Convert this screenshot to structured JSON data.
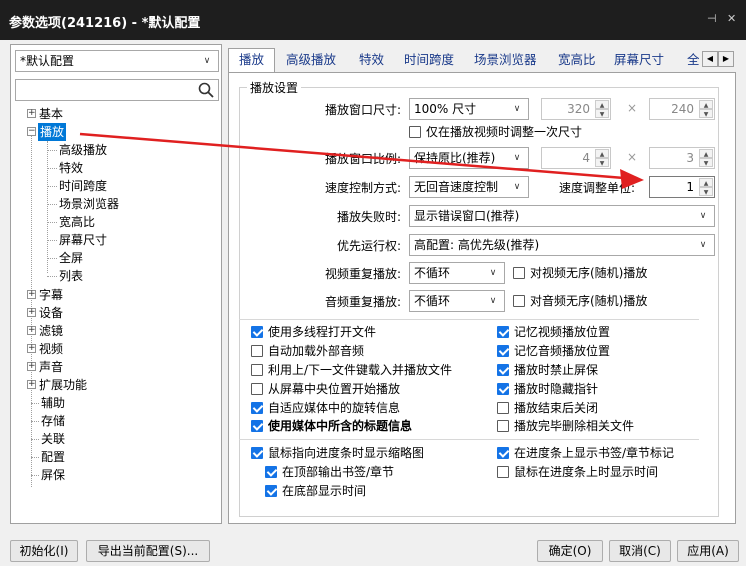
{
  "window": {
    "title": "参数选项(241216) - *默认配置",
    "pin_glyph": "⊣",
    "close_glyph": "✕"
  },
  "profile_select": {
    "value": "*默认配置"
  },
  "search": {
    "placeholder": ""
  },
  "tree": {
    "basic": "基本",
    "playback": "播放",
    "playback_children": [
      "高级播放",
      "特效",
      "时间跨度",
      "场景浏览器",
      "宽高比",
      "屏幕尺寸",
      "全屏",
      "列表"
    ],
    "subtitle": "字幕",
    "device": "设备",
    "filter": "滤镜",
    "video": "视频",
    "audio": "声音",
    "extension": "扩展功能",
    "assist": "辅助",
    "storage": "存储",
    "association": "关联",
    "config": "配置",
    "skin": "屏保"
  },
  "tabs": [
    "播放",
    "高级播放",
    "特效",
    "时间跨度",
    "场景浏览器",
    "宽高比",
    "屏幕尺寸",
    "全"
  ],
  "group": {
    "title": "播放设置"
  },
  "rows": {
    "window_size": {
      "label": "播放窗口尺寸:",
      "value": "100% 尺寸",
      "w": "320",
      "h": "240",
      "times": "×"
    },
    "only_on_start": "仅在播放视频时调整一次尺寸",
    "aspect": {
      "label": "播放窗口比例:",
      "value": "保持原比(推荐)",
      "w": "4",
      "h": "3",
      "times": "×"
    },
    "speed_mode": {
      "label": "速度控制方式:",
      "value": "无回音速度控制"
    },
    "speed_unit": {
      "label": "速度调整单位:",
      "value": "1"
    },
    "on_fail": {
      "label": "播放失败时:",
      "value": "显示错误窗口(推荐)"
    },
    "priority": {
      "label": "优先运行权:",
      "value": "高配置: 高优先级(推荐)"
    },
    "video_repeat": {
      "label": "视频重复播放:",
      "value": "不循环",
      "random": "对视频无序(随机)播放"
    },
    "audio_repeat": {
      "label": "音频重复播放:",
      "value": "不循环",
      "random": "对音频无序(随机)播放"
    }
  },
  "checks_left": [
    {
      "label": "使用多线程打开文件",
      "checked": true
    },
    {
      "label": "自动加载外部音频",
      "checked": false
    },
    {
      "label": "利用上/下一文件键载入并播放文件",
      "checked": false
    },
    {
      "label": "从屏幕中央位置开始播放",
      "checked": false
    },
    {
      "label": "自适应媒体中的旋转信息",
      "checked": true
    },
    {
      "label": "使用媒体中所含的标题信息",
      "checked": true
    }
  ],
  "checks_right": [
    {
      "label": "记忆视频播放位置",
      "checked": true
    },
    {
      "label": "记忆音频播放位置",
      "checked": true
    },
    {
      "label": "播放时禁止屏保",
      "checked": true
    },
    {
      "label": "播放时隐藏指针",
      "checked": true
    },
    {
      "label": "播放结束后关闭",
      "checked": false
    },
    {
      "label": "播放完毕删除相关文件",
      "checked": false
    }
  ],
  "checks_bottom": {
    "thumb": {
      "label": "鼠标指向进度条时显示缩略图",
      "checked": true
    },
    "bookmark": {
      "label": "在进度条上显示书签/章节标记",
      "checked": true
    },
    "top_bookmark": {
      "label": "在顶部输出书签/章节",
      "checked": true
    },
    "bottom_time": {
      "label": "在底部显示时间",
      "checked": true
    },
    "mouse_time": {
      "label": "鼠标在进度条上时显示时间",
      "checked": false
    }
  },
  "buttons": {
    "init": "初始化(I)",
    "export": "导出当前配置(S)...",
    "ok": "确定(O)",
    "cancel": "取消(C)",
    "apply": "应用(A)"
  },
  "arrow_color": "#e02020",
  "accent": "#0078d7"
}
